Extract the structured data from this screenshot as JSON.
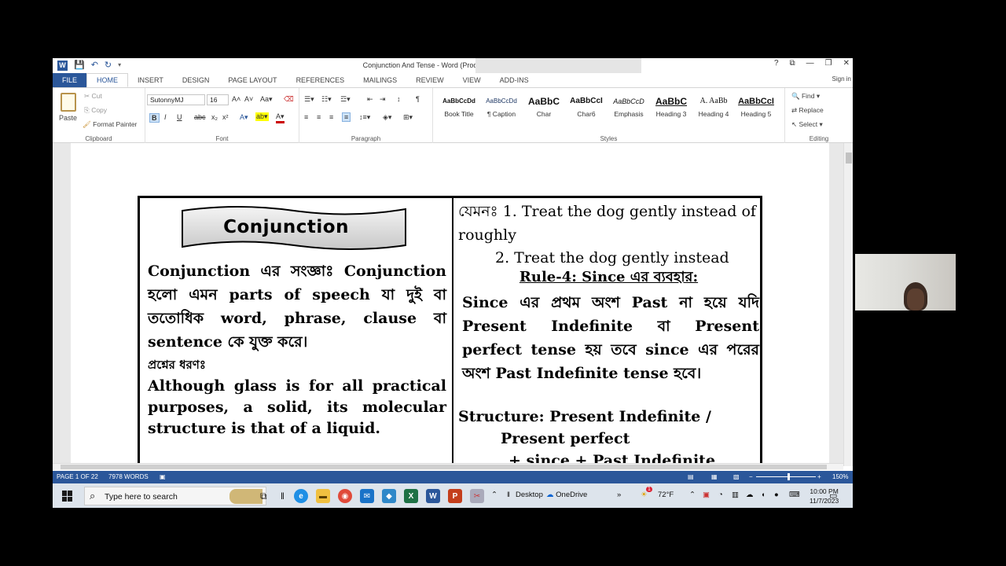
{
  "window": {
    "title": "Conjunction And Tense - Word (Product Activation Failed)",
    "signin": "Sign in",
    "buttons": [
      "?",
      "⧉",
      "—",
      "❐",
      "✕"
    ]
  },
  "tabs": [
    "FILE",
    "HOME",
    "INSERT",
    "DESIGN",
    "PAGE LAYOUT",
    "REFERENCES",
    "MAILINGS",
    "REVIEW",
    "VIEW",
    "ADD-INS"
  ],
  "ribbon": {
    "clipboard": {
      "paste": "Paste",
      "cut": "Cut",
      "copy": "Copy",
      "format_painter": "Format Painter",
      "label": "Clipboard"
    },
    "font": {
      "name": "SutonnyMJ",
      "size": "16",
      "label": "Font"
    },
    "paragraph": {
      "label": "Paragraph"
    },
    "styles": {
      "label": "Styles",
      "items": [
        {
          "preview": "AaBbCcDd",
          "name": "Book Title"
        },
        {
          "preview": "AaBbCcDd",
          "name": "¶ Caption"
        },
        {
          "preview": "AaBbC",
          "name": "Char"
        },
        {
          "preview": "AaBbCcI",
          "name": "Char6"
        },
        {
          "preview": "AaBbCcD",
          "name": "Emphasis"
        },
        {
          "preview": "AaBbC",
          "name": "Heading 3"
        },
        {
          "preview": "A.  AaBb",
          "name": "Heading 4"
        },
        {
          "preview": "AaBbCcI",
          "name": "Heading 5"
        }
      ]
    },
    "editing": {
      "find": "Find",
      "replace": "Replace",
      "select": "Select",
      "label": "Editing"
    }
  },
  "document": {
    "banner": "Conjunction",
    "left": {
      "definition": "Conjunction এর সংজ্ঞাঃ Conjunction হলো এমন parts of speech যা দুই বা ততোধিক word, phrase, clause বা sentence কে যুক্ত করে।",
      "question": "প্রশ্নের ধরণঃ",
      "example": "Although glass is for all practical purposes, a solid, its molecular structure is that of a liquid."
    },
    "right": {
      "ex1": "যেমনঃ 1. Treat the dog gently instead of roughly",
      "ex2": "2. Treat the dog gently instead",
      "rule": "Rule-4: Since এর ব্যবহার:",
      "rule_text": "Since এর প্রথম অংশ Past না হয়ে যদি Present Indefinite বা Present perfect tense হয় তবে since এর পরের অংশ Past Indefinite tense হবে।",
      "structure1": "Structure: Present Indefinite /",
      "structure2": "Present perfect",
      "structure3": "+ since + Past Indefinite"
    }
  },
  "status": {
    "page": "PAGE 1 OF 22",
    "words": "7978 WORDS",
    "zoom": "150%"
  },
  "taskbar": {
    "search_placeholder": "Type here to search",
    "desktop": "Desktop",
    "onedrive": "OneDrive",
    "weather": "72°F",
    "time": "10:00 PM",
    "date": "11/7/2023",
    "weather_badge": "1"
  }
}
